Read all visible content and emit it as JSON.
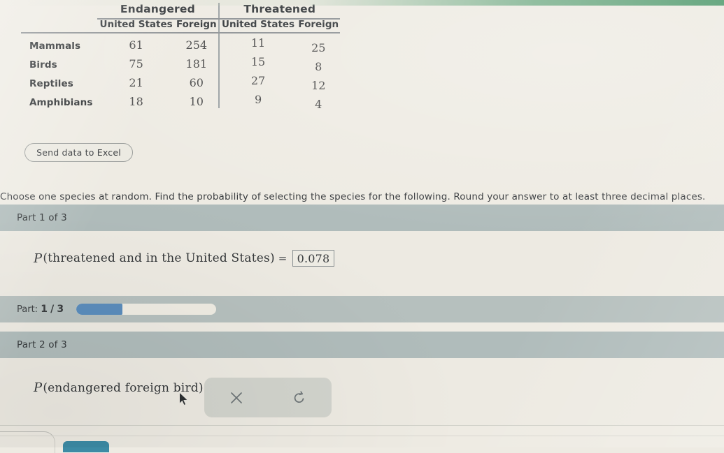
{
  "table": {
    "group_headers": [
      "Endangered",
      "Threatened"
    ],
    "sub_headers": [
      "United States",
      "Foreign",
      "United States",
      "Foreign"
    ],
    "rows": [
      {
        "label": "Mammals",
        "values": [
          "61",
          "254",
          "11",
          "25"
        ]
      },
      {
        "label": "Birds",
        "values": [
          "75",
          "181",
          "15",
          "8"
        ]
      },
      {
        "label": "Reptiles",
        "values": [
          "21",
          "60",
          "27",
          "12"
        ]
      },
      {
        "label": "Amphibians",
        "values": [
          "18",
          "10",
          "9",
          "4"
        ]
      }
    ]
  },
  "buttons": {
    "send_excel": "Send data to Excel"
  },
  "prompt": "Choose one species at random. Find the probability of selecting the species for the following. Round your answer to at least three decimal places.",
  "parts": [
    {
      "header": "Part 1 of 3",
      "expr_var": "P",
      "expr_text": "(threatened and in the United States)",
      "equals": "=",
      "answer": "0.078",
      "answer_empty": false
    },
    {
      "header": "Part 2 of 3",
      "expr_var": "P",
      "expr_text": "(endangered foreign bird)",
      "equals": "=",
      "answer": "",
      "answer_empty": true
    }
  ],
  "progress": {
    "label_prefix": "Part:",
    "current": "1",
    "separator": "/",
    "total": "3",
    "percent": 33,
    "fill_color": "#5b8dbc"
  },
  "tools": {
    "clear_icon": "x-icon",
    "undo_icon": "undo-arrow-icon"
  },
  "colors": {
    "page_background": "#eeebe3",
    "band_header": "#b0bcbb",
    "progress_band": "#b6c0be",
    "accent_blue": "#5b8dbc",
    "bottom_button_blue": "#3d8ba5",
    "top_strip_green": "#4a9668"
  }
}
